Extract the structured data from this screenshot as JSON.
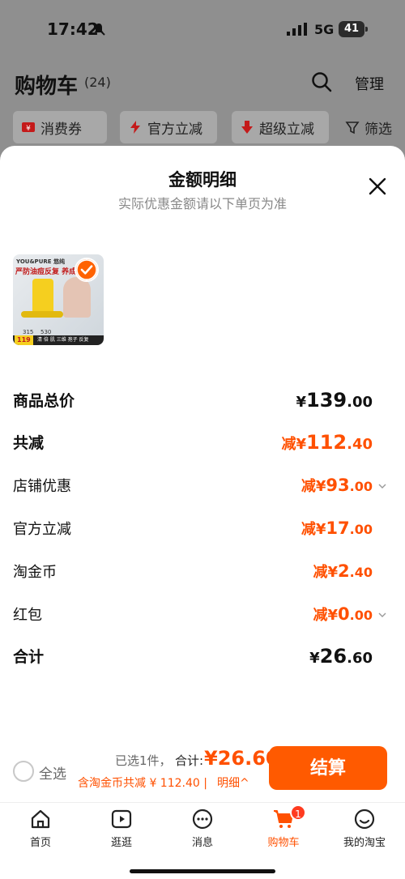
{
  "status_bar": {
    "time": "17:42",
    "network": "5G",
    "battery": "41"
  },
  "cart_header": {
    "title": "购物车",
    "count": "(24)",
    "manage": "管理"
  },
  "filters": [
    {
      "label": "消费券",
      "icon": "coupon-icon"
    },
    {
      "label": "官方立减",
      "icon": "lightning-icon"
    },
    {
      "label": "超级立减",
      "icon": "down-arrow-icon"
    },
    {
      "label": "筛选",
      "icon": "funnel-icon"
    }
  ],
  "sheet": {
    "title": "金额明细",
    "subtitle": "实际优惠金额请以下单页为准",
    "product_thumb": {
      "brand": "YOU&PURE 悠纯",
      "headline": "严防油痘反复 养成不长",
      "price_a": "315",
      "price_b": "530",
      "footer": "清 倍 肌 三维 孢子 反复",
      "footer_price": "119"
    },
    "rows": {
      "goods_total": {
        "label": "商品总价",
        "prefix": "¥",
        "int": "139",
        "dec": ".00"
      },
      "total_reduce": {
        "label": "共减",
        "prefix": "减¥",
        "int": "112",
        "dec": ".40"
      },
      "shop_discount": {
        "label": "店铺优惠",
        "prefix": "减¥",
        "int": "93",
        "dec": ".00"
      },
      "official_reduce": {
        "label": "官方立减",
        "prefix": "减¥",
        "int": "17",
        "dec": ".00"
      },
      "tao_coin": {
        "label": "淘金币",
        "prefix": "减¥",
        "int": "2",
        "dec": ".40"
      },
      "red_packet": {
        "label": "红包",
        "prefix": "减¥",
        "int": "0",
        "dec": ".00"
      },
      "sum": {
        "label": "合计",
        "prefix": "¥",
        "int": "26",
        "dec": ".60"
      }
    }
  },
  "checkout": {
    "select_all": "全选",
    "selected": "已选1件，",
    "total_label": "合计:",
    "total_value": "¥26.60",
    "coin_line": "含淘金币共减 ¥ 112.40 |",
    "detail_link": "明细^",
    "button": "结算"
  },
  "tabbar": [
    {
      "label": "首页",
      "icon": "home-icon"
    },
    {
      "label": "逛逛",
      "icon": "play-icon"
    },
    {
      "label": "消息",
      "icon": "chat-icon"
    },
    {
      "label": "购物车",
      "icon": "cart-icon",
      "badge": "1",
      "active": true
    },
    {
      "label": "我的淘宝",
      "icon": "smile-icon"
    }
  ],
  "colors": {
    "accent": "#ff5000",
    "button": "#ff5a00",
    "dim": "#8f8f8f"
  }
}
